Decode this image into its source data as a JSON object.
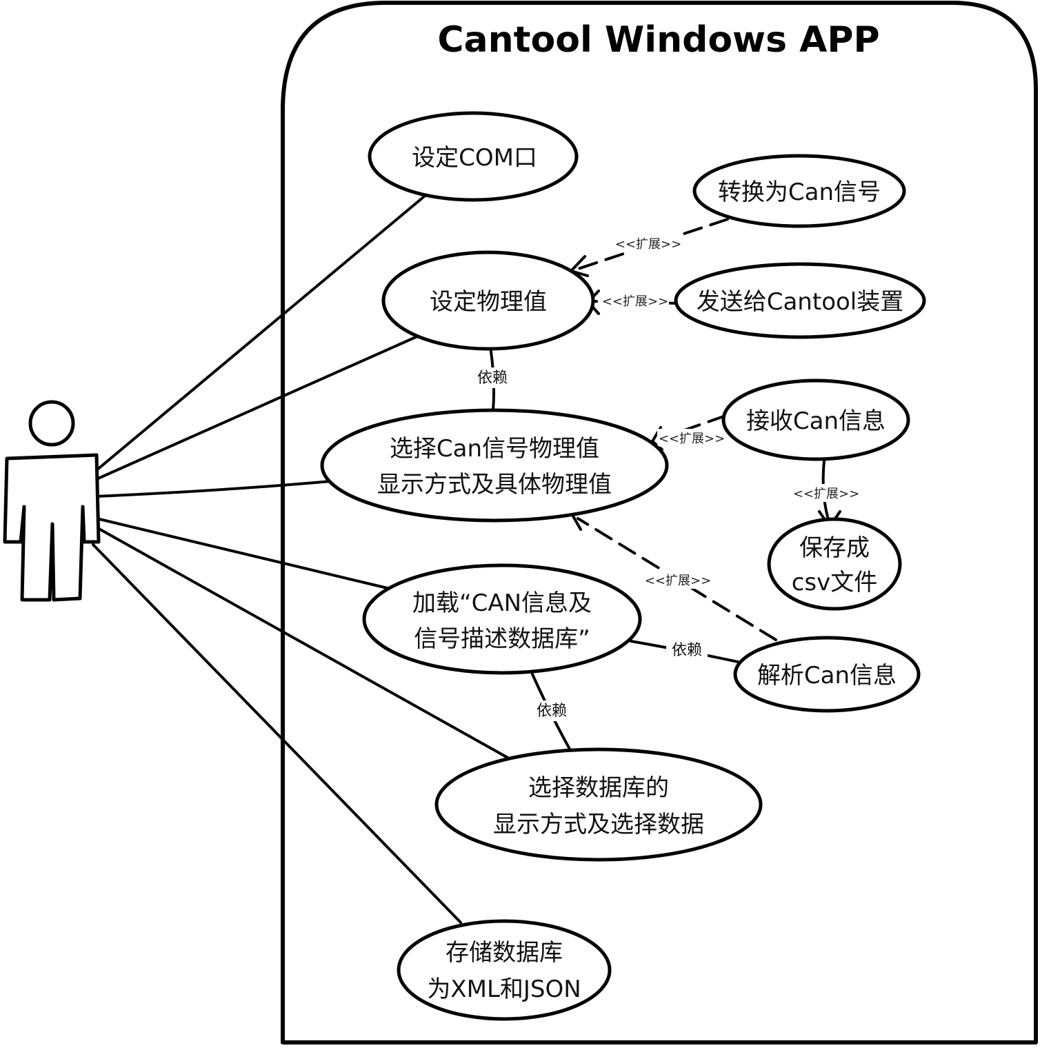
{
  "diagram": {
    "title": "Cantool Windows APP",
    "use_cases": {
      "set_com_port": [
        "设定COM口"
      ],
      "convert_to_can_signal": [
        "转换为Can信号"
      ],
      "set_physical_value": [
        "设定物理值"
      ],
      "send_to_cantool_device": [
        "发送给Cantool装置"
      ],
      "select_can_signal_display": [
        "选择Can信号物理值",
        "显示方式及具体物理值"
      ],
      "receive_can_info": [
        "接收Can信息"
      ],
      "save_as_csv": [
        "保存成",
        "csv文件"
      ],
      "load_can_database": [
        "加载“CAN信息及",
        "信号描述数据库”"
      ],
      "parse_can_info": [
        "解析Can信息"
      ],
      "select_database_display": [
        "选择数据库的",
        "显示方式及选择数据"
      ],
      "store_database_xml_json": [
        "存储数据库",
        "为XML和JSON"
      ]
    },
    "relations": {
      "extend_label": "<<扩展>>",
      "depend_label": "依赖"
    }
  }
}
